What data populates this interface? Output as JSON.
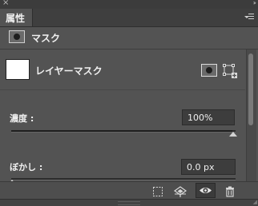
{
  "window": {
    "close_glyph": "×",
    "collapse_glyph": "››"
  },
  "tabs": [
    {
      "label": "属性",
      "active": true
    }
  ],
  "header": {
    "title": "マスク",
    "icon": "pixel-mask-icon"
  },
  "mask": {
    "row_label": "レイヤーマスク",
    "thumbnail_color": "#ffffff",
    "buttons": [
      {
        "name": "select-pixel-mask",
        "icon": "pixel-mask-icon"
      },
      {
        "name": "add-vector-mask",
        "icon": "vector-mask-icon"
      }
    ]
  },
  "density": {
    "label": "濃度 :",
    "value": "100%",
    "level": 1.0
  },
  "feather": {
    "label": "ぼかし :",
    "value": "0.0 px",
    "level": 0.0
  },
  "bottom_bar": {
    "icons": [
      "load-selection-icon",
      "apply-mask-icon",
      "visibility-eye-icon",
      "trash-icon"
    ]
  },
  "colors": {
    "panel_bg": "#535353",
    "field_bg": "#3d3d3d",
    "text": "#f0f0f0"
  }
}
